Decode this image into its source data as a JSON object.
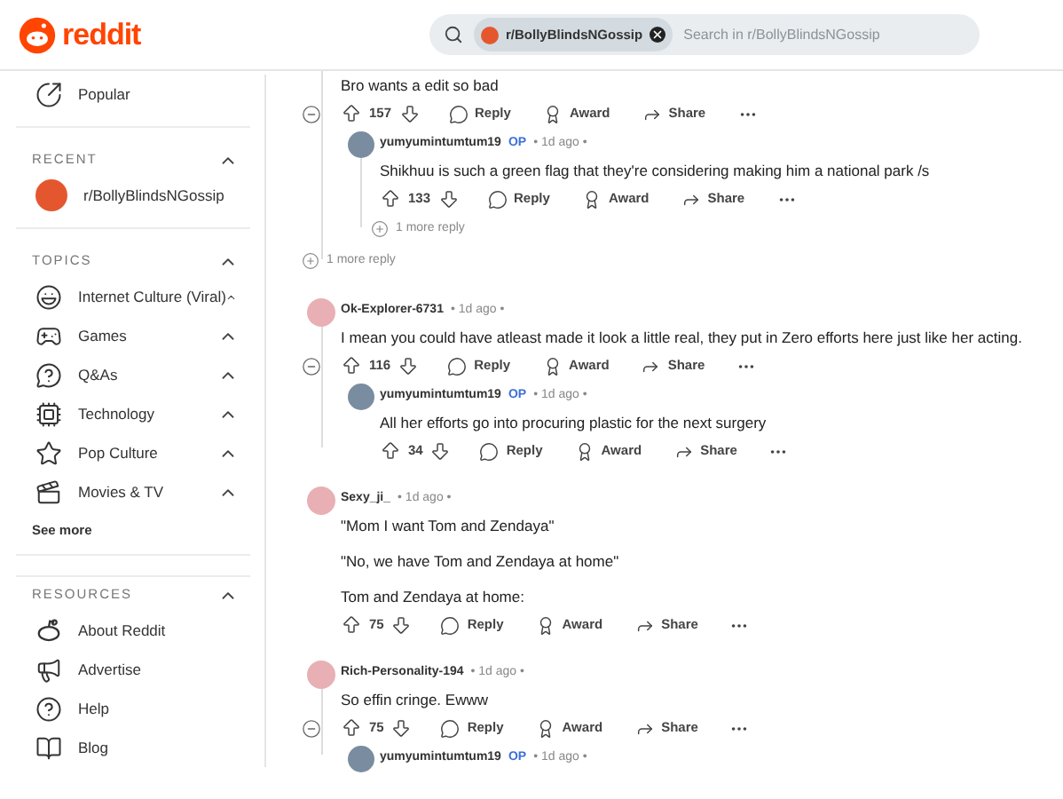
{
  "header": {
    "logo": "reddit",
    "search": {
      "community": "r/BollyBlindsNGossip",
      "placeholder": "Search in r/BollyBlindsNGossip"
    }
  },
  "sidebar": {
    "top": [
      {
        "kind": "popular",
        "label": "Popular"
      }
    ],
    "sections": [
      {
        "title": "RECENT",
        "expanded": true,
        "items": [
          {
            "kind": "community",
            "label": "r/BollyBlindsNGossip"
          }
        ]
      },
      {
        "title": "TOPICS",
        "expanded": true,
        "items": [
          {
            "kind": "laugh",
            "label": "Internet Culture (Viral)",
            "expanded": true
          },
          {
            "kind": "gamepad",
            "label": "Games",
            "expanded": true
          },
          {
            "kind": "question",
            "label": "Q&As",
            "expanded": true
          },
          {
            "kind": "chip",
            "label": "Technology",
            "expanded": true
          },
          {
            "kind": "star",
            "label": "Pop Culture",
            "expanded": true
          },
          {
            "kind": "clapper",
            "label": "Movies & TV",
            "expanded": true
          }
        ],
        "see_more": "See more"
      },
      {
        "title": "RESOURCES",
        "expanded": true,
        "items": [
          {
            "kind": "reddit",
            "label": "About Reddit"
          },
          {
            "kind": "megaphone",
            "label": "Advertise"
          },
          {
            "kind": "help",
            "label": "Help"
          },
          {
            "kind": "book",
            "label": "Blog"
          }
        ]
      }
    ]
  },
  "comments": [
    {
      "body": [
        "Bro wants a edit so bad"
      ],
      "votes": "157",
      "collapsible": true,
      "actions": {
        "reply": "Reply",
        "award": "Award",
        "share": "Share"
      },
      "more": "1 more reply",
      "children": [
        {
          "author": "yumyumintumtum19",
          "op": "OP",
          "time": "• 1d ago •",
          "body": [
            "Shikhuu is such a green flag that they're considering making him a national park /s"
          ],
          "votes": "133",
          "collapsible": false,
          "actions": {
            "reply": "Reply",
            "award": "Award",
            "share": "Share"
          },
          "more": "1 more reply"
        }
      ]
    },
    {
      "author": "Ok-Explorer-6731",
      "time": "• 1d ago •",
      "body": [
        "I mean you could have atleast made it look a little real, they put in Zero efforts here just like her acting."
      ],
      "votes": "116",
      "collapsible": true,
      "actions": {
        "reply": "Reply",
        "award": "Award",
        "share": "Share"
      },
      "children": [
        {
          "author": "yumyumintumtum19",
          "op": "OP",
          "time": "• 1d ago •",
          "body": [
            "All her efforts go into procuring plastic for the next surgery"
          ],
          "votes": "34",
          "collapsible": false,
          "actions": {
            "reply": "Reply",
            "award": "Award",
            "share": "Share"
          }
        }
      ]
    },
    {
      "author": "Sexy_ji_",
      "time": "• 1d ago •",
      "body": [
        "\"Mom I want Tom and Zendaya\"",
        "\"No, we have Tom and Zendaya at home\"",
        "Tom and Zendaya at home:"
      ],
      "votes": "75",
      "collapsible": false,
      "actions": {
        "reply": "Reply",
        "award": "Award",
        "share": "Share"
      }
    },
    {
      "author": "Rich-Personality-194",
      "time": "• 1d ago •",
      "body": [
        "So effin cringe. Ewww"
      ],
      "votes": "75",
      "collapsible": true,
      "actions": {
        "reply": "Reply",
        "award": "Award",
        "share": "Share"
      },
      "children": [
        {
          "author": "yumyumintumtum19",
          "op": "OP",
          "time": "• 1d ago •"
        }
      ]
    }
  ]
}
